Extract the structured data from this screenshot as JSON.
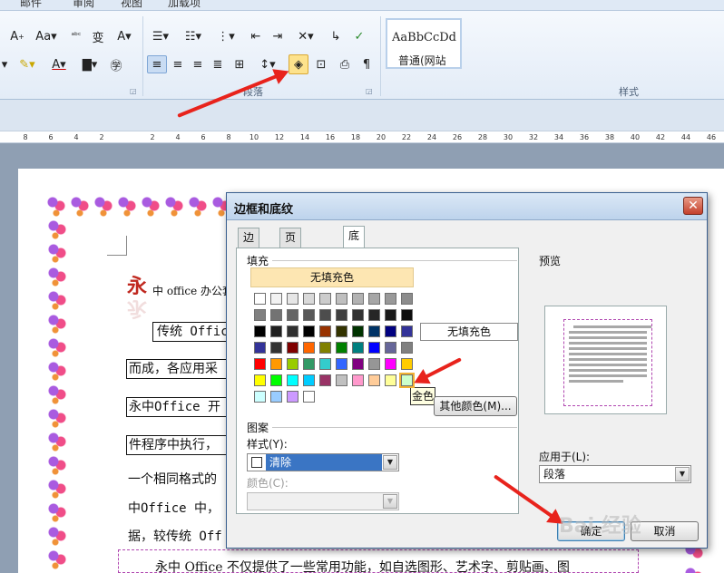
{
  "menubar": {
    "items": [
      "邮件",
      "审阅",
      "视图",
      "加载项"
    ]
  },
  "ribbon": {
    "paragraph_group_label": "段落",
    "styles_group_label": "样式",
    "style_sample": "AaBbCcDd",
    "style_name": "普通(网站"
  },
  "ruler": {
    "ticks": [
      "8",
      "6",
      "4",
      "2",
      "",
      "2",
      "4",
      "6",
      "8",
      "10",
      "12",
      "14",
      "16",
      "18",
      "20",
      "22",
      "24",
      "26",
      "28",
      "30",
      "32",
      "34",
      "36",
      "38",
      "40",
      "42",
      "44",
      "46"
    ]
  },
  "document": {
    "dropcap": "永",
    "line1_rest": "中 office 办公套",
    "line2": "传统 Offic",
    "line3": "而成，各应用采",
    "line4": "永中Office 开",
    "line5": "件程序中执行，",
    "line6": "一个相同格式的",
    "line7": "中Office 中，",
    "line8": "据，较传统 Off",
    "last_para": "永中 Office 不仅提供了一些常用功能，如自选图形、艺术字、剪贴画、图"
  },
  "dialog": {
    "title": "边框和底纹",
    "tabs": [
      "边框",
      "页面边框",
      "底纹"
    ],
    "selected_tab": "底纹",
    "fill_section": "填充",
    "no_fill_label": "无填充色",
    "fill_preview_text": "无填充色",
    "tooltip": "金色",
    "more_colors_button": "其他颜色(M)...",
    "pattern_section": "图案",
    "style_label": "样式(Y):",
    "style_value": "清除",
    "color_label": "颜色(C):",
    "preview_section": "预览",
    "apply_to_label": "应用于(L):",
    "apply_to_value": "段落",
    "ok_button": "确定",
    "cancel_button": "取消",
    "palette": [
      [
        "#ffffff",
        "#f2f2f2",
        "#e6e6e6",
        "#d9d9d9",
        "#cccccc",
        "#bfbfbf",
        "#b2b2b2",
        "#a6a6a6",
        "#999999",
        "#8c8c8c"
      ],
      [
        "#808080",
        "#737373",
        "#666666",
        "#595959",
        "#4d4d4d",
        "#404040",
        "#333333",
        "#262626",
        "#1a1a1a",
        "#0d0d0d"
      ],
      [
        "#000000",
        "#202020",
        "#303030",
        "#000000",
        "#993300",
        "#333300",
        "#003300",
        "#003366",
        "#000080",
        "#333399"
      ],
      [
        "#333399",
        "#333333",
        "#800000",
        "#ff6600",
        "#808000",
        "#008000",
        "#008080",
        "#0000ff",
        "#666699",
        "#808080"
      ],
      [
        "#ff0000",
        "#ff9900",
        "#99cc00",
        "#339966",
        "#33cccc",
        "#3366ff",
        "#800080",
        "#969696",
        "#ff00ff",
        "#ffcc00"
      ],
      [
        "#ffff00",
        "#00ff00",
        "#00ffff",
        "#00ccff",
        "#993366",
        "#c0c0c0",
        "#ff99cc",
        "#ffcc99",
        "#ffff99",
        "#ccffcc"
      ],
      [
        "#ccffff",
        "#99ccff",
        "#cc99ff",
        "#ffffff"
      ]
    ],
    "hover_swatch_color": "#ffcc00"
  },
  "watermark": "Bai 经验"
}
